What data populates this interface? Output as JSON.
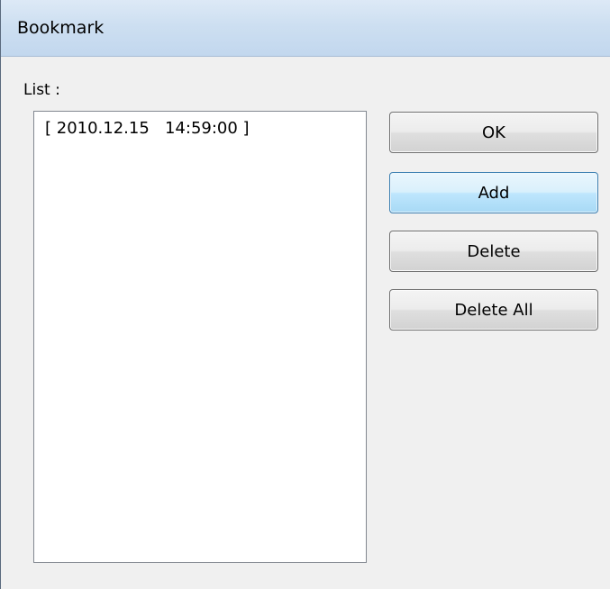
{
  "window": {
    "title": "Bookmark"
  },
  "list": {
    "label": "List :",
    "items": [
      "[ 2010.12.15   14:59:00 ]"
    ]
  },
  "buttons": {
    "ok": "OK",
    "add": "Add",
    "delete": "Delete",
    "delete_all": "Delete All"
  },
  "colors": {
    "titlebar": "#cddff1",
    "focused_button": "#bee6fd",
    "dialog_background": "#f0f0f0"
  }
}
